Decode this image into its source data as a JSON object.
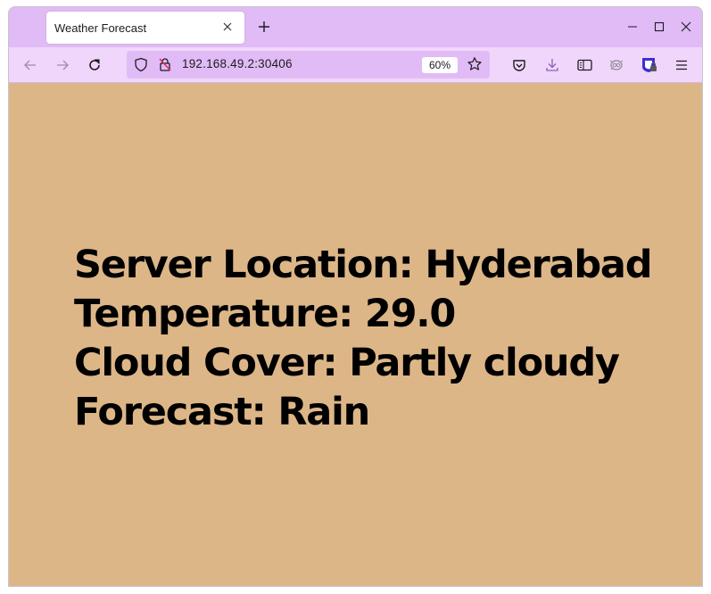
{
  "browser": {
    "tab": {
      "title": "Weather Forecast",
      "close_icon": "close-icon"
    },
    "new_tab_label": "+",
    "window_controls": {
      "minimize": "minimize-icon",
      "maximize": "maximize-icon",
      "close": "close-icon"
    },
    "navigation": {
      "back": "arrow-left-icon",
      "forward": "arrow-right-icon",
      "reload": "reload-icon"
    },
    "urlbar": {
      "url": "192.168.49.2:30406",
      "zoom_level": "60%",
      "tracking_icon": "shield-icon",
      "insecure_icon": "lock-slash-icon",
      "bookmark_icon": "star-icon"
    },
    "toolbar_icons": [
      "pocket-icon",
      "download-icon",
      "reader-view-icon",
      "extension-icon",
      "privacy-extension-icon",
      "hamburger-menu-icon"
    ]
  },
  "page": {
    "background_color": "#ddb688",
    "lines": [
      {
        "label": "Server Location",
        "value": "Hyderabad",
        "text": "Server Location: Hyderabad"
      },
      {
        "label": "Temperature",
        "value": "29.0",
        "text": "Temperature: 29.0"
      },
      {
        "label": "Cloud Cover",
        "value": "Partly cloudy",
        "text": "Cloud Cover: Partly cloudy"
      },
      {
        "label": "Forecast",
        "value": "Rain",
        "text": "Forecast: Rain"
      }
    ]
  },
  "colors": {
    "titlebar": "#e0bbf5",
    "navbar": "#f0d6fa",
    "urlbar": "#e1bbf5",
    "accent_download": "#8c5fb8",
    "extension_blue": "#3a2fd6"
  }
}
